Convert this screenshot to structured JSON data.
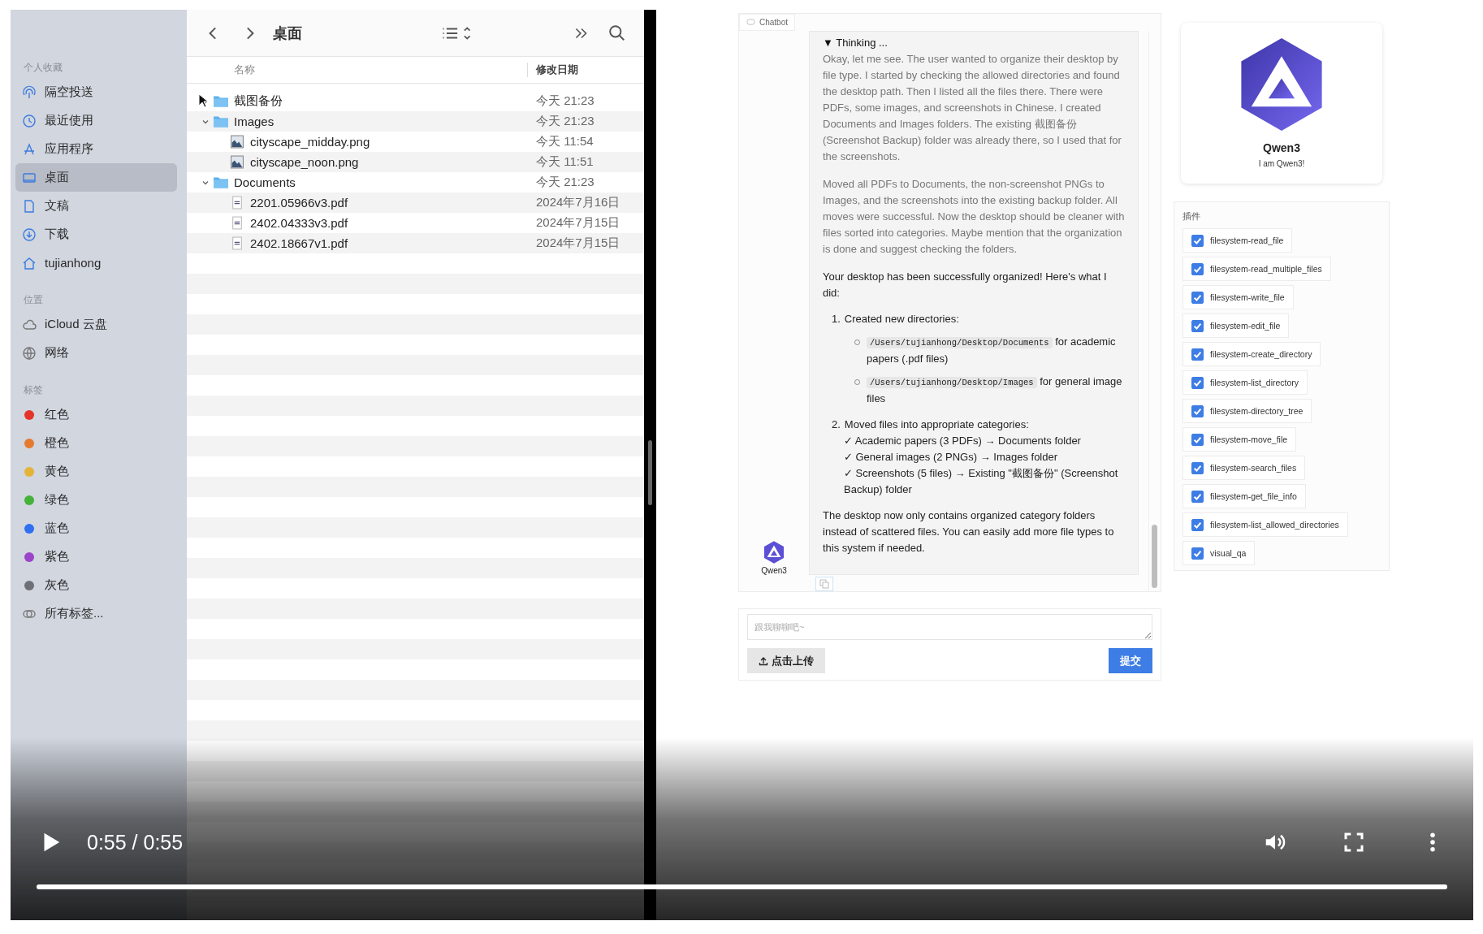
{
  "finder": {
    "sidebar": [
      {
        "heading": "个人收藏",
        "items": [
          {
            "label": "隔空投送",
            "kind": "airdrop",
            "selected": false
          },
          {
            "label": "最近使用",
            "kind": "recents",
            "selected": false
          },
          {
            "label": "应用程序",
            "kind": "applications",
            "selected": false
          },
          {
            "label": "桌面",
            "kind": "desktop",
            "selected": true
          },
          {
            "label": "文稿",
            "kind": "documents",
            "selected": false
          },
          {
            "label": "下载",
            "kind": "downloads",
            "selected": false
          },
          {
            "label": "tujianhong",
            "kind": "home",
            "selected": false
          }
        ]
      },
      {
        "heading": "位置",
        "items": [
          {
            "label": "iCloud 云盘",
            "kind": "icloud",
            "selected": false
          },
          {
            "label": "网络",
            "kind": "network",
            "selected": false
          }
        ]
      },
      {
        "heading": "标签",
        "items": [
          {
            "label": "红色",
            "kind": "tag",
            "color": "#e5342b",
            "selected": false
          },
          {
            "label": "橙色",
            "kind": "tag",
            "color": "#e57a2e",
            "selected": false
          },
          {
            "label": "黄色",
            "kind": "tag",
            "color": "#e5b33a",
            "selected": false
          },
          {
            "label": "绿色",
            "kind": "tag",
            "color": "#45b23a",
            "selected": false
          },
          {
            "label": "蓝色",
            "kind": "tag",
            "color": "#2f6ff0",
            "selected": false
          },
          {
            "label": "紫色",
            "kind": "tag",
            "color": "#9b45c9",
            "selected": false
          },
          {
            "label": "灰色",
            "kind": "tag",
            "color": "#6f7076",
            "selected": false
          },
          {
            "label": "所有标签...",
            "kind": "alltags",
            "selected": false
          }
        ]
      }
    ],
    "title": "桌面",
    "columns": [
      "名称",
      "修改日期"
    ],
    "files": [
      {
        "name": "截图备份",
        "kind": "folder",
        "date": "今天 21:23",
        "expanded": false
      },
      {
        "name": "Images",
        "kind": "folder",
        "date": "今天 21:23",
        "expanded": true,
        "children": [
          {
            "name": "cityscape_midday.png",
            "kind": "image",
            "date": "今天 11:54"
          },
          {
            "name": "cityscape_noon.png",
            "kind": "image",
            "date": "今天 11:51"
          }
        ]
      },
      {
        "name": "Documents",
        "kind": "folder",
        "date": "今天 21:23",
        "expanded": true,
        "children": [
          {
            "name": "2201.05966v3.pdf",
            "kind": "pdf",
            "date": "2024年7月16日"
          },
          {
            "name": "2402.04333v3.pdf",
            "kind": "pdf",
            "date": "2024年7月15日"
          },
          {
            "name": "2402.18667v1.pdf",
            "kind": "pdf",
            "date": "2024年7月15日"
          }
        ]
      }
    ]
  },
  "chat": {
    "label": "Chatbot",
    "avatar_name": "Qwen3",
    "thinking": {
      "title": "▼ Thinking ...",
      "paragraphs": [
        "Okay, let me see. The user wanted to organize their desktop by file type. I started by checking the allowed directories and found the desktop path. Then I listed all the files there. There were PDFs, some images, and screenshots in Chinese. I created Documents and Images folders. The existing 截图备份 (Screenshot Backup) folder was already there, so I used that for the screenshots.",
        "Moved all PDFs to Documents, the non-screenshot PNGs to Images, and the screenshots into the existing backup folder. All moves were successful. Now the desktop should be cleaner with files sorted into categories. Maybe mention that the organization is done and suggest checking the folders."
      ]
    },
    "answer": {
      "intro": "Your desktop has been successfully organized! Here's what I did:",
      "steps": [
        {
          "number": "1.",
          "text": "Created new directories:",
          "bullets": [
            {
              "code": "/Users/tujianhong/Desktop/Documents",
              "text": "for academic papers (.pdf files)"
            },
            {
              "code": "/Users/tujianhong/Desktop/Images",
              "text": "for general image files"
            }
          ]
        },
        {
          "number": "2.",
          "text": "Moved files into appropriate categories:",
          "checks": [
            "✓ Academic papers (3 PDFs) → Documents folder",
            "✓ General images (2 PNGs) → Images folder",
            "✓ Screenshots (5 files) → Existing \"截图备份\" (Screenshot Backup) folder"
          ]
        }
      ],
      "outro": "The desktop now only contains organized category folders instead of scattered files. You can easily add more file types to this system if needed."
    },
    "input": {
      "placeholder": "跟我聊聊吧~"
    },
    "upload_button": "点击上传",
    "submit_button": "提交"
  },
  "agent": {
    "name": "Qwen3",
    "description": "I am Qwen3!"
  },
  "plugins": {
    "title": "插件",
    "items": [
      {
        "label": "filesystem-read_file",
        "checked": true
      },
      {
        "label": "filesystem-read_multiple_files",
        "checked": true
      },
      {
        "label": "filesystem-write_file",
        "checked": true
      },
      {
        "label": "filesystem-edit_file",
        "checked": true
      },
      {
        "label": "filesystem-create_directory",
        "checked": true
      },
      {
        "label": "filesystem-list_directory",
        "checked": true
      },
      {
        "label": "filesystem-directory_tree",
        "checked": true
      },
      {
        "label": "filesystem-move_file",
        "checked": true
      },
      {
        "label": "filesystem-search_files",
        "checked": true
      },
      {
        "label": "filesystem-get_file_info",
        "checked": true
      },
      {
        "label": "filesystem-list_allowed_directories",
        "checked": true
      },
      {
        "label": "visual_qa",
        "checked": true
      }
    ]
  },
  "player": {
    "playing": false,
    "time": "0:55 / 0:55",
    "progress": {
      "level": 1
    }
  }
}
